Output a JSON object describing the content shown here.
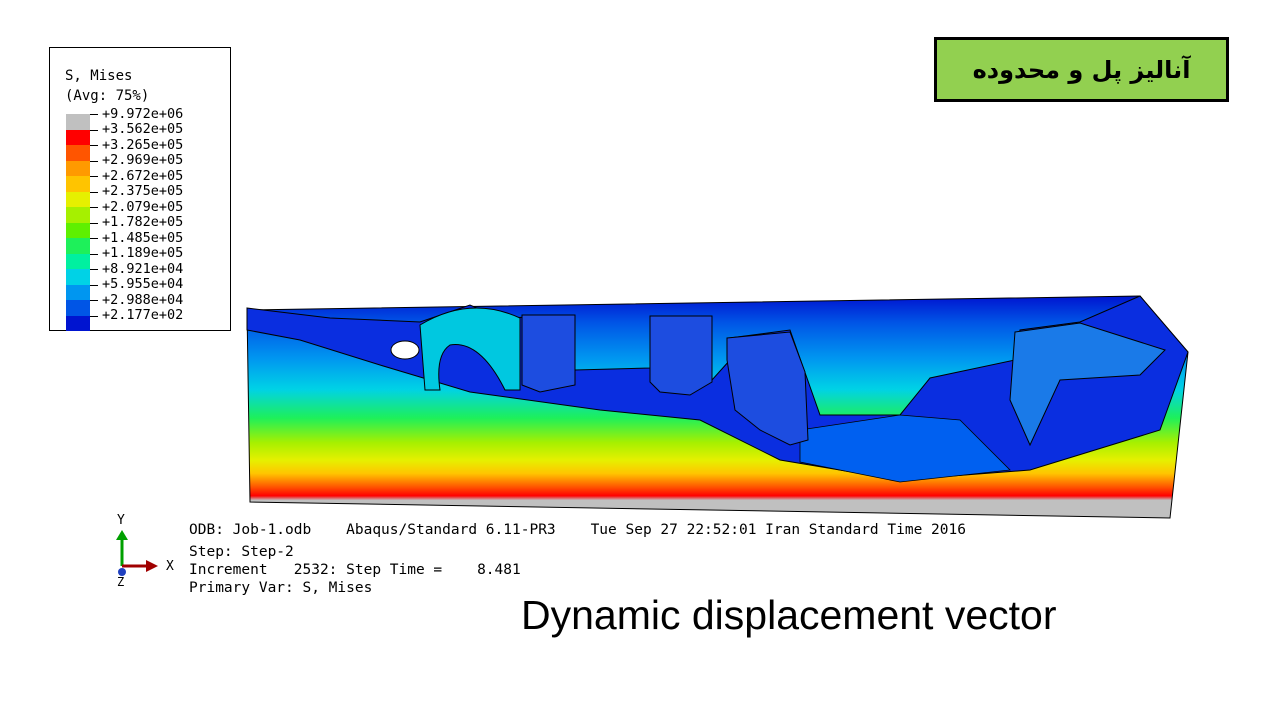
{
  "title_box": {
    "text": "آنالیز پل و محدوده",
    "bg_color": "#92d050"
  },
  "legend": {
    "title_line1": "S, Mises",
    "title_line2": "(Avg: 75%)",
    "labels": [
      "+9.972e+06",
      "+3.562e+05",
      "+3.265e+05",
      "+2.969e+05",
      "+2.672e+05",
      "+2.375e+05",
      "+2.079e+05",
      "+1.782e+05",
      "+1.485e+05",
      "+1.189e+05",
      "+8.921e+04",
      "+5.955e+04",
      "+2.988e+04",
      "+2.177e+02"
    ],
    "colors": [
      "#c0c0c0",
      "#ff0000",
      "#ff5500",
      "#ff9a00",
      "#ffc400",
      "#e6f000",
      "#a6f000",
      "#5ef000",
      "#1ef05a",
      "#00f0a0",
      "#00d2e6",
      "#0096f0",
      "#0055e6",
      "#0014d0"
    ]
  },
  "info": {
    "odb_line": "ODB: Job-1.odb    Abaqus/Standard 6.11-PR3    Tue Sep 27 22:52:01 Iran Standard Time 2016",
    "step_line": "Step: Step-2",
    "increment_line": "Increment   2532: Step Time =    8.481",
    "primary_var_line": "Primary Var: S, Mises"
  },
  "triad": {
    "y_label": "Y",
    "x_label": "X",
    "z_label": "Z"
  },
  "caption": "Dynamic displacement vector"
}
